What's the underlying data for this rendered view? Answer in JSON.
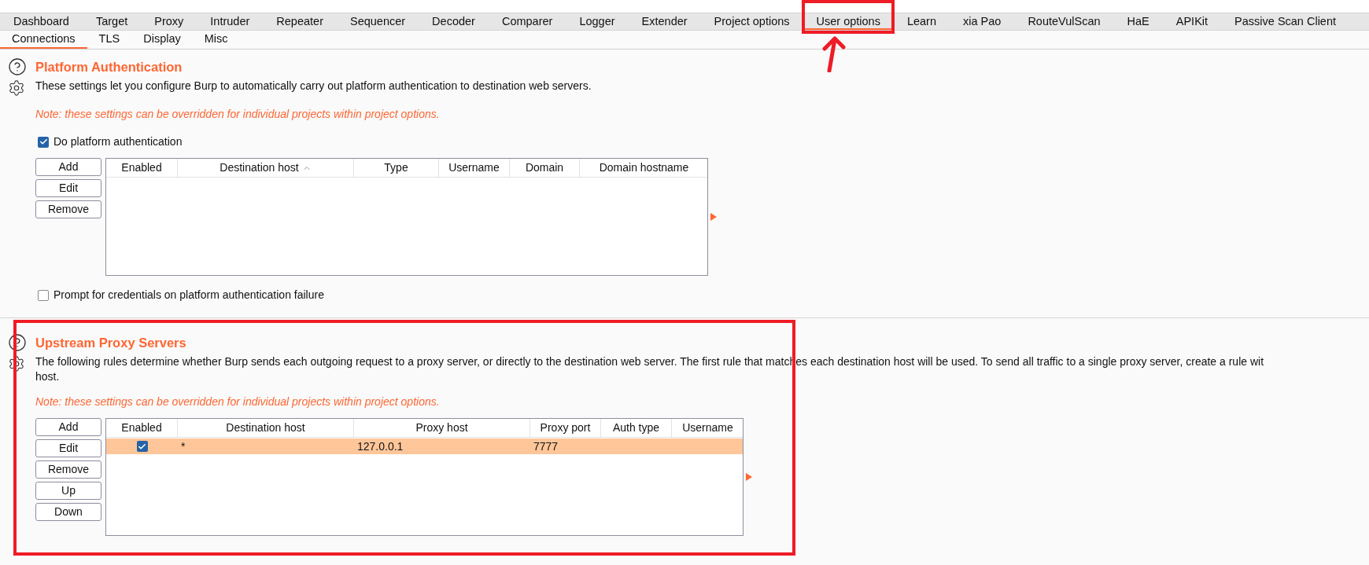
{
  "main_tabs": [
    {
      "label": "Dashboard",
      "selected": false
    },
    {
      "label": "Target",
      "selected": false
    },
    {
      "label": "Proxy",
      "selected": false
    },
    {
      "label": "Intruder",
      "selected": false
    },
    {
      "label": "Repeater",
      "selected": false
    },
    {
      "label": "Sequencer",
      "selected": false
    },
    {
      "label": "Decoder",
      "selected": false
    },
    {
      "label": "Comparer",
      "selected": false
    },
    {
      "label": "Logger",
      "selected": false
    },
    {
      "label": "Extender",
      "selected": false
    },
    {
      "label": "Project options",
      "selected": false
    },
    {
      "label": "User options",
      "selected": true
    },
    {
      "label": "Learn",
      "selected": false
    },
    {
      "label": "xia Pao",
      "selected": false
    },
    {
      "label": "RouteVulScan",
      "selected": false
    },
    {
      "label": "HaE",
      "selected": false
    },
    {
      "label": "APIKit",
      "selected": false
    },
    {
      "label": "Passive Scan Client",
      "selected": false
    }
  ],
  "sub_tabs": [
    {
      "label": "Connections",
      "selected": true
    },
    {
      "label": "TLS",
      "selected": false
    },
    {
      "label": "Display",
      "selected": false
    },
    {
      "label": "Misc",
      "selected": false
    }
  ],
  "sections": [
    {
      "title": "Platform Authentication",
      "description": [
        "These settings let you configure Burp to automatically carry out platform authentication to destination web servers."
      ],
      "note": "Note: these settings can be overridden for individual projects within project options.",
      "top_checkbox": {
        "label": "Do platform authentication",
        "checked": true
      },
      "buttons": [
        "Add",
        "Edit",
        "Remove"
      ],
      "table": {
        "columns": [
          {
            "label": "Enabled",
            "sorted": false
          },
          {
            "label": "Destination host",
            "sorted": true
          },
          {
            "label": "Type",
            "sorted": false
          },
          {
            "label": "Username",
            "sorted": false
          },
          {
            "label": "Domain",
            "sorted": false
          },
          {
            "label": "Domain hostname",
            "sorted": false
          }
        ]
      },
      "bottom_checkbox": {
        "label": "Prompt for credentials on platform authentication failure",
        "checked": false
      }
    },
    {
      "title": "Upstream Proxy Servers",
      "description": [
        "The following rules determine whether Burp sends each outgoing request to a proxy server, or directly to the destination web server. The first rule that matches each destination host will be used. To send all traffic to a single proxy server, create a rule wit",
        "host."
      ],
      "note": "Note: these settings can be overridden for individual projects within project options.",
      "buttons": [
        "Add",
        "Edit",
        "Remove",
        "Up",
        "Down"
      ],
      "table": {
        "columns": [
          {
            "label": "Enabled",
            "sorted": false
          },
          {
            "label": "Destination host",
            "sorted": false
          },
          {
            "label": "Proxy host",
            "sorted": false
          },
          {
            "label": "Proxy port",
            "sorted": false
          },
          {
            "label": "Auth type",
            "sorted": false
          },
          {
            "label": "Username",
            "sorted": false
          }
        ],
        "rows": [
          {
            "selected": true,
            "cells": [
              {
                "kind": "checkbox",
                "checked": true
              },
              {
                "kind": "text",
                "text": "*"
              },
              {
                "kind": "text",
                "text": "127.0.0.1"
              },
              {
                "kind": "text",
                "text": "7777"
              }
            ]
          }
        ]
      }
    }
  ]
}
